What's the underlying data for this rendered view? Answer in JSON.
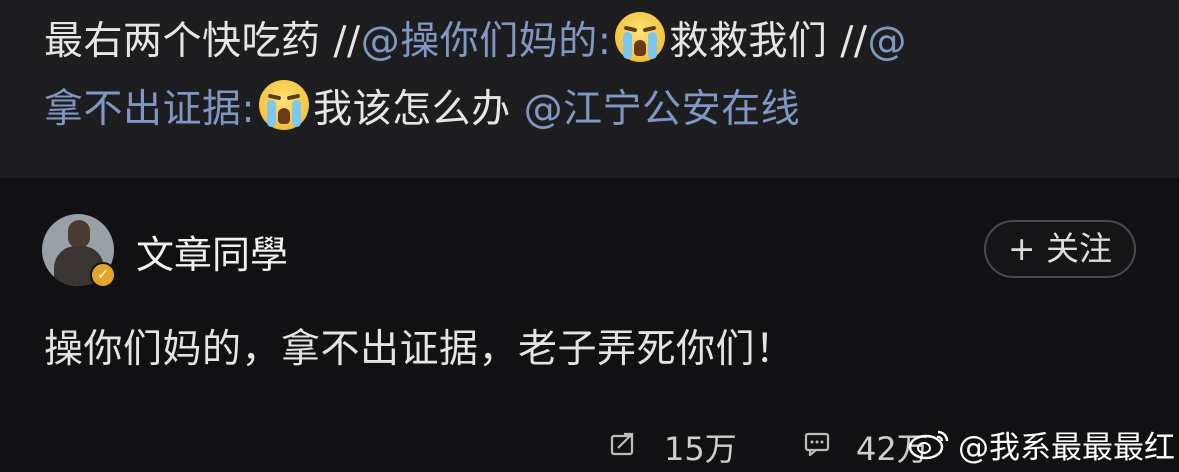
{
  "repost": {
    "line1_text": "最右两个快吃药 //",
    "mention1": "@操你们妈的",
    "colon1": ":",
    "emoji1_icon": "crying-face-icon",
    "text2": "救救我们 //",
    "mention2_at": "@",
    "mention2_name": "拿不出证据",
    "colon2": ":",
    "emoji2_icon": "crying-face-icon",
    "text3": "我该怎么办 ",
    "mention3": "@江宁公安在线"
  },
  "post": {
    "username": "文章同學",
    "verified_icon": "verified-badge-icon",
    "follow_label": "+ 关注",
    "content": "操你们妈的，拿不出证据，老子弄死你们！"
  },
  "actions": {
    "repost_count": "15万",
    "comment_count": "42万",
    "repost_icon": "repost-icon",
    "comment_icon": "comment-icon"
  },
  "watermark": {
    "text": "@我系最最最红",
    "icon": "weibo-logo-icon"
  }
}
